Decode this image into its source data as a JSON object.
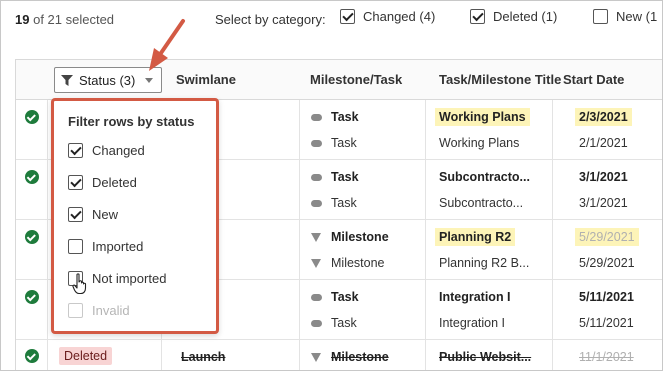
{
  "selection": {
    "count": "19",
    "suffix": "of 21 selected"
  },
  "category_filter": {
    "label": "Select by category:",
    "items": [
      {
        "label": "Changed (4)",
        "checked": true
      },
      {
        "label": "Deleted (1)",
        "checked": true
      },
      {
        "label": "New (1",
        "checked": false
      }
    ]
  },
  "columns": {
    "status_button": "Status (3)",
    "swimlane": "Swimlane",
    "milestone_task": "Milestone/Task",
    "title": "Task/Milestone Title",
    "start_date": "Start Date"
  },
  "rows": [
    {
      "lines": [
        {
          "type": "Task",
          "title": "Working Plans",
          "start": "2/3/2021",
          "bold": true,
          "highlight": true
        },
        {
          "type": "Task",
          "title": "Working Plans",
          "start": "2/1/2021"
        }
      ]
    },
    {
      "lines": [
        {
          "type": "Task",
          "title": "Subcontracto...",
          "start": "3/1/2021",
          "bold": true
        },
        {
          "type": "Task",
          "title": "Subcontracto...",
          "start": "3/1/2021"
        }
      ]
    },
    {
      "lines": [
        {
          "type": "Milestone",
          "title": "Planning R2",
          "start": "5/29/2021",
          "bold": true,
          "highlight": true,
          "faded_date": true
        },
        {
          "type": "Milestone",
          "title": "Planning R2 B...",
          "start": "5/29/2021"
        }
      ]
    },
    {
      "lines": [
        {
          "type": "Task",
          "title": "Integration I",
          "start": "5/11/2021",
          "bold": true
        },
        {
          "type": "Task",
          "title": "Integration I",
          "start": "5/11/2021"
        }
      ]
    },
    {
      "status_badge": "Deleted",
      "swimlane": "Launch",
      "lines": [
        {
          "type": "Milestone",
          "title": "Public Websit...",
          "start": "11/1/2021",
          "bold": true,
          "strike": true
        }
      ]
    }
  ],
  "status_filter_popup": {
    "title": "Filter rows by status",
    "options": [
      {
        "label": "Changed",
        "checked": true,
        "disabled": false
      },
      {
        "label": "Deleted",
        "checked": true,
        "disabled": false
      },
      {
        "label": "New",
        "checked": true,
        "disabled": false
      },
      {
        "label": "Imported",
        "checked": false,
        "disabled": false
      },
      {
        "label": "Not imported",
        "checked": false,
        "disabled": false
      },
      {
        "label": "Invalid",
        "checked": false,
        "disabled": true
      }
    ]
  },
  "colors": {
    "accent": "#d35a44",
    "ok": "#1e7b3c",
    "highlight": "#fdf4b8",
    "deleted_badge": "#f8d4d4"
  },
  "icons": [
    "filter-icon",
    "chevron-down-icon",
    "check-circle-icon",
    "task-icon",
    "milestone-icon",
    "hand-cursor-icon",
    "arrow-annotation"
  ]
}
